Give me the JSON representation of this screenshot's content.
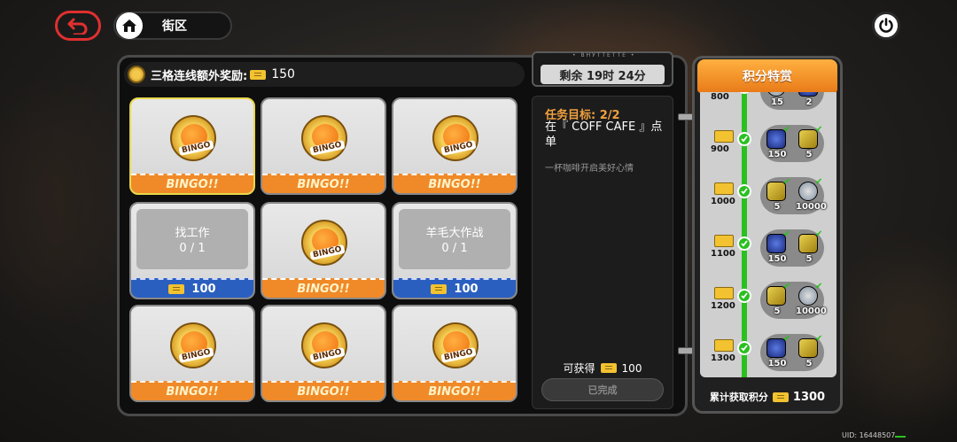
{
  "nav": {
    "location": "街区"
  },
  "bonus": {
    "label": "三格连线额外奖励:",
    "value": "150"
  },
  "timer": {
    "deco": "• ВНУТТЕТТЕ •",
    "remaining": "剩余 19时 24分"
  },
  "grid": {
    "bingo_label": "BINGO!!",
    "badge_text": "BINGO",
    "task1": {
      "name": "找工作",
      "progress": "0 / 1",
      "reward": "100"
    },
    "task2": {
      "name": "羊毛大作战",
      "progress": "0 / 1",
      "reward": "100"
    }
  },
  "detail": {
    "goal": "任务目标: 2/2",
    "description": "在『 COFF CAFE 』点单",
    "flavor": "一杯咖啡开启美好心情",
    "reward_label": "可获得",
    "reward_value": "100",
    "status_button": "已完成"
  },
  "rewards_panel": {
    "title": "积分特赏",
    "milestones": [
      {
        "points": "800",
        "items": [
          {
            "type": "silver",
            "count": "15"
          },
          {
            "type": "blue",
            "count": "2"
          }
        ]
      },
      {
        "points": "900",
        "items": [
          {
            "type": "blue",
            "count": "150"
          },
          {
            "type": "gold",
            "count": "5"
          }
        ]
      },
      {
        "points": "1000",
        "items": [
          {
            "type": "gold",
            "count": "5"
          },
          {
            "type": "silver",
            "count": "10000"
          }
        ]
      },
      {
        "points": "1100",
        "items": [
          {
            "type": "blue",
            "count": "150"
          },
          {
            "type": "gold",
            "count": "5"
          }
        ]
      },
      {
        "points": "1200",
        "items": [
          {
            "type": "gold",
            "count": "5"
          },
          {
            "type": "silver",
            "count": "10000"
          }
        ]
      },
      {
        "points": "1300",
        "items": [
          {
            "type": "blue",
            "count": "150"
          },
          {
            "type": "gold",
            "count": "5"
          }
        ]
      }
    ],
    "total_label": "累计获取积分",
    "total_value": "1300"
  },
  "footer": {
    "uid": "UID: 16448507"
  },
  "colors": {
    "accent_orange": "#f08a28",
    "reward_blue": "#2a5fc0",
    "progress_green": "#2ac020",
    "back_red": "#e03030"
  }
}
